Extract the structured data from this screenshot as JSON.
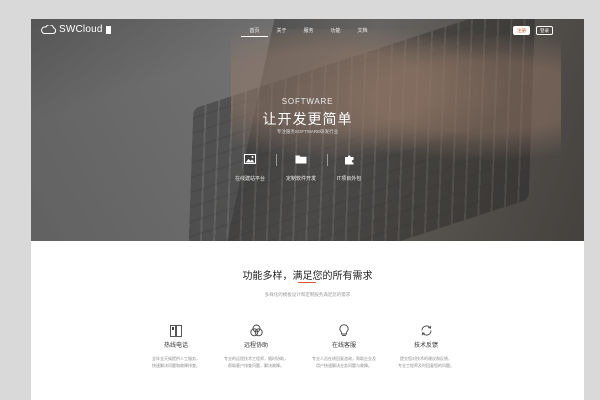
{
  "header": {
    "logo_text": "SWCloud",
    "nav": [
      "首页",
      "关于",
      "服务",
      "功能",
      "文档"
    ],
    "login_label": "注册",
    "register_label": "登录"
  },
  "hero": {
    "kicker": "SOFTWARE",
    "title": "让开发更简单",
    "subtitle": "专注服务SOFTWARE研发行业",
    "features": [
      {
        "icon": "image-icon",
        "label": "在线建站平台"
      },
      {
        "icon": "folder-icon",
        "label": "定制软件开发"
      },
      {
        "icon": "puzzle-icon",
        "label": "IT项目外包"
      }
    ]
  },
  "section": {
    "title": "功能多样，满足您的所有需求",
    "subtitle": "多样化的模板设计和定制服务满足您的需求",
    "services": [
      {
        "icon": "hotline-icon",
        "name": "热线电话",
        "desc": [
          "全年全天候提供人工服务，",
          "快速解决问题和故障排查。"
        ]
      },
      {
        "icon": "remote-assist-icon",
        "name": "远程协助",
        "desc": [
          "专业的远程技术工程师，随时协助，",
          "帮助客户排查问题，解决故障。"
        ]
      },
      {
        "icon": "online-support-icon",
        "name": "在线客服",
        "desc": [
          "专业人员在线回复咨询，帮助企业及",
          "用户快速解决业务问题与故障。"
        ]
      },
      {
        "icon": "feedback-icon",
        "name": "技术反馈",
        "desc": [
          "提交您对技术的建议和反馈，",
          "专业工程师及时回复您的问题。"
        ]
      }
    ]
  },
  "colors": {
    "accent": "#e0582a",
    "hero_overlay": "#1e1e1e"
  }
}
